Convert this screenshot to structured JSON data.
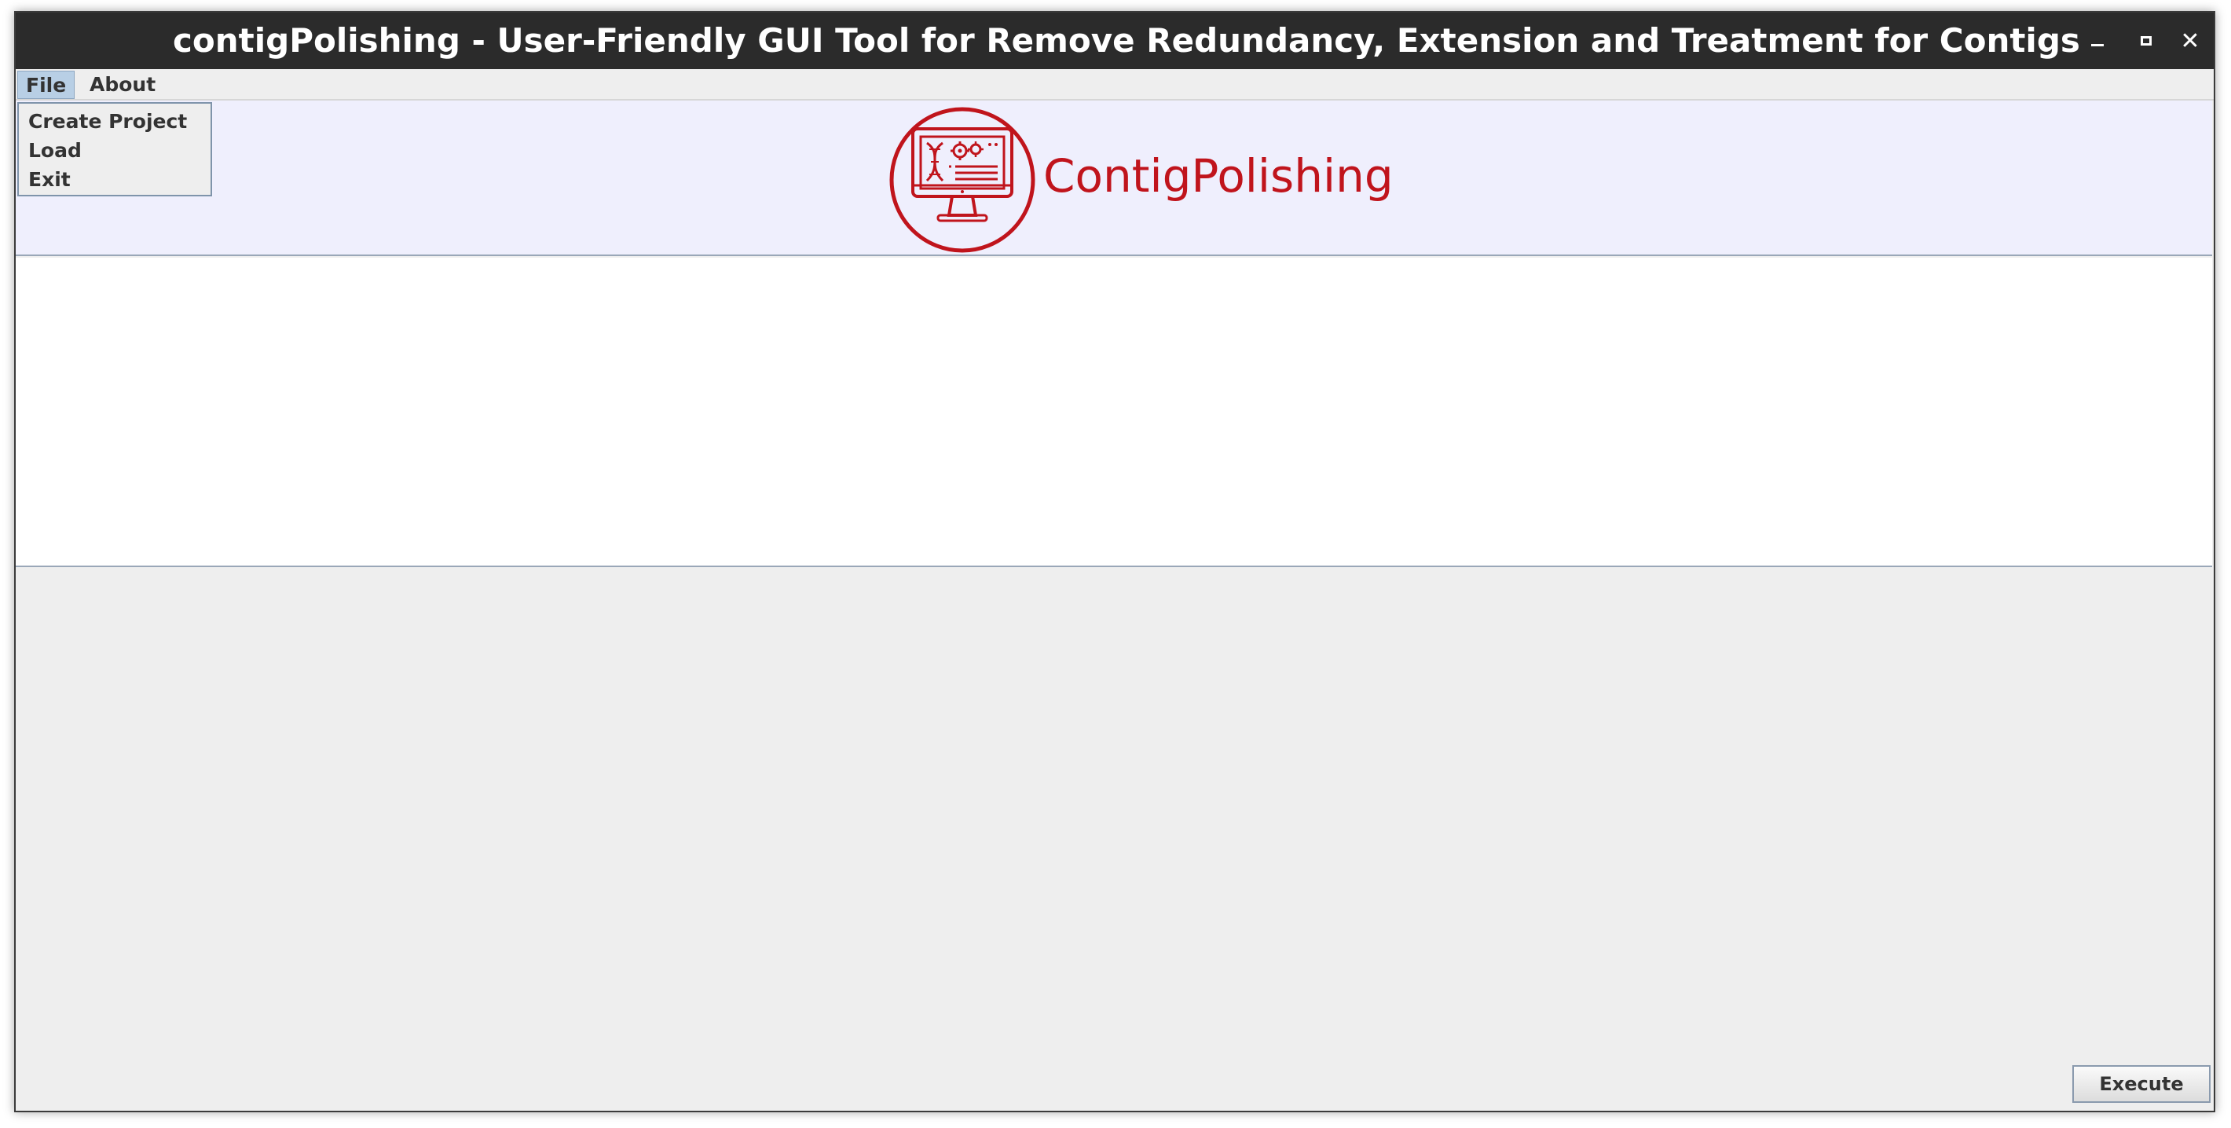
{
  "window": {
    "title": "contigPolishing - User-Friendly GUI Tool for Remove Redundancy, Extension and Treatment for Contigs",
    "controls": {
      "minimize_icon": "minimize-icon",
      "maximize_icon": "maximize-icon",
      "close_icon": "close-icon",
      "close_glyph": "✕"
    }
  },
  "menubar": {
    "items": [
      {
        "label": "File",
        "open": true
      },
      {
        "label": "About",
        "open": false
      }
    ]
  },
  "file_menu": {
    "items": [
      {
        "label": "Create Project"
      },
      {
        "label": "Load"
      },
      {
        "label": "Exit"
      }
    ]
  },
  "header": {
    "logo_icon": "dna-monitor-logo-icon",
    "logo_text": "ContigPolishing",
    "brand_color": "#c0141c",
    "background_color": "#efeffd"
  },
  "footer": {
    "execute_label": "Execute"
  }
}
